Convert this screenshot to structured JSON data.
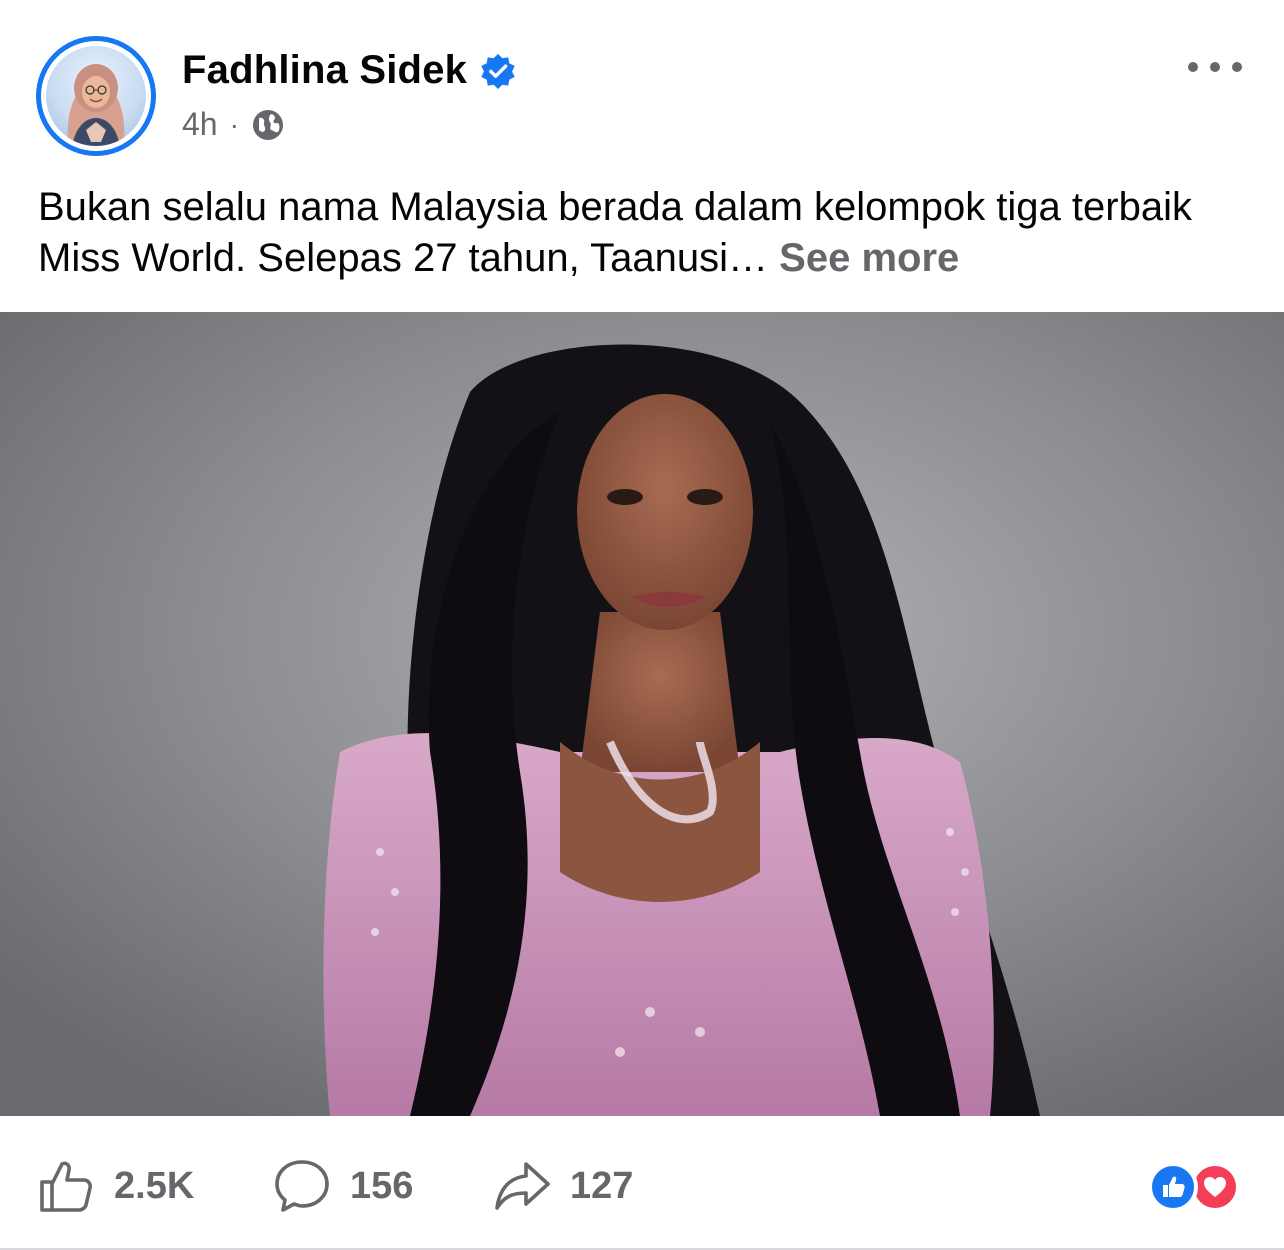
{
  "author": {
    "name": "Fadhlina Sidek",
    "verified": true,
    "time": "4h",
    "separator": "·",
    "audience_icon": "globe-icon"
  },
  "post": {
    "text": "Bukan selalu nama Malaysia berada dalam kelompok tiga terbaik Miss World. Selepas 27 tahun, Taanusi…",
    "see_more": "See more"
  },
  "stats": {
    "likes": "2.5K",
    "comments": "156",
    "shares": "127"
  },
  "colors": {
    "accent": "#1877f2",
    "secondary_text": "#65676b",
    "love": "#f33e58"
  }
}
